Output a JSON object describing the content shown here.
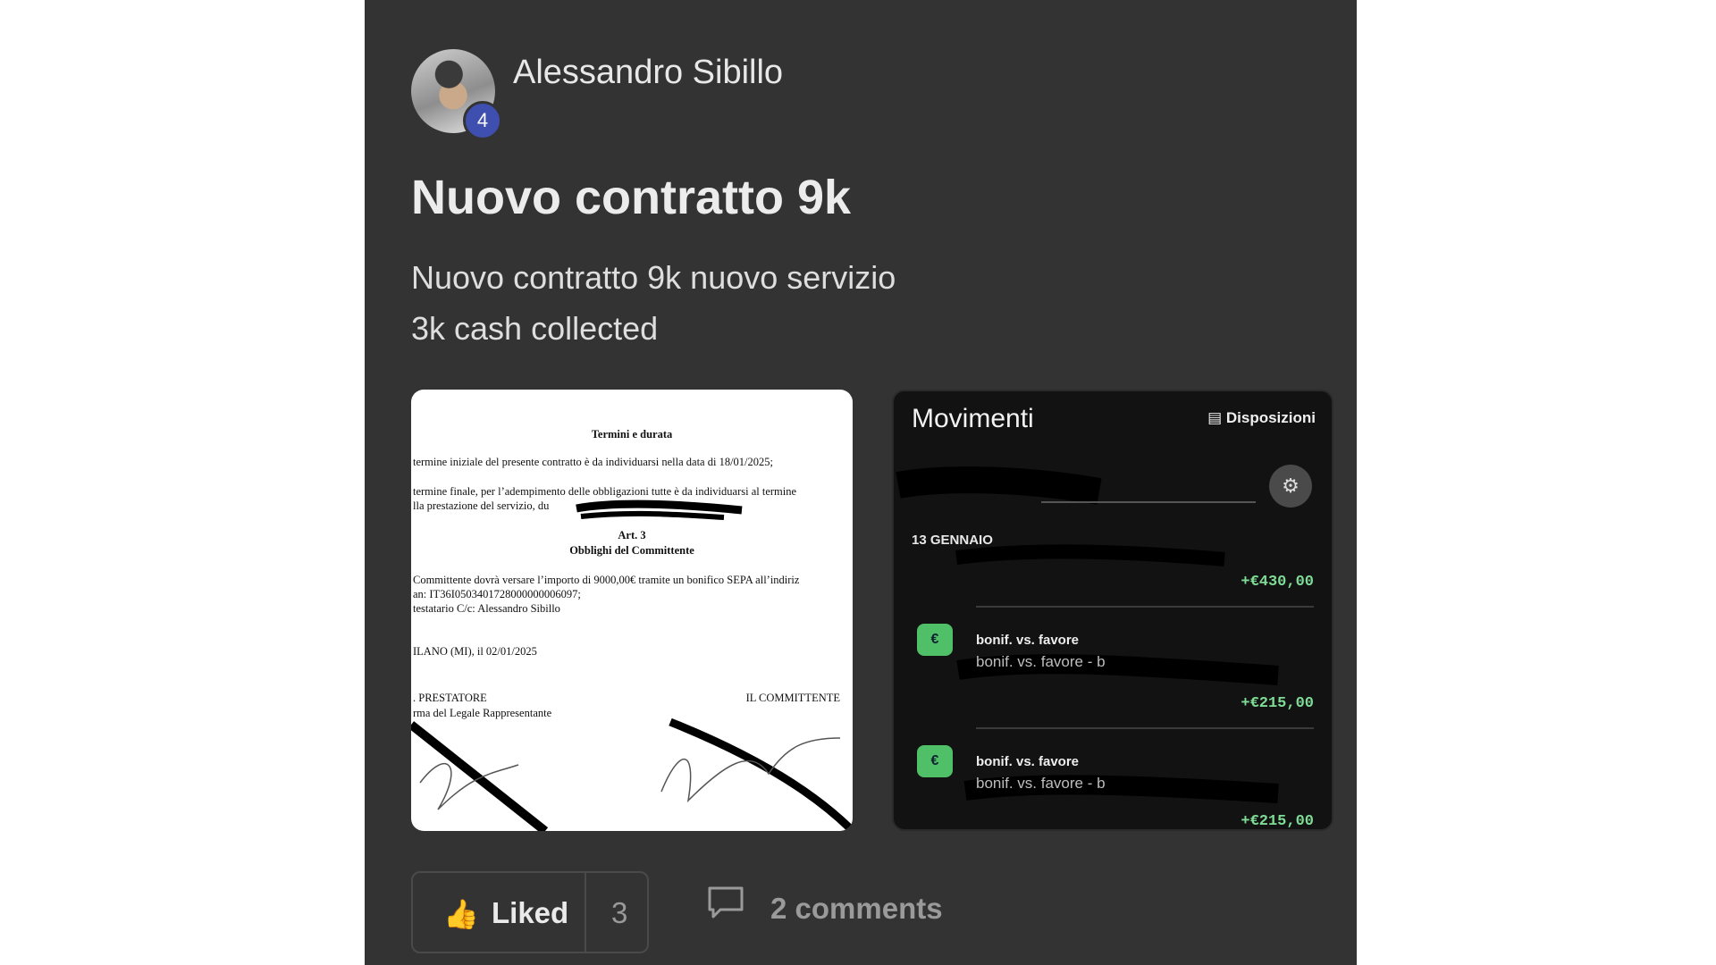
{
  "post": {
    "author": "Alessandro Sibillo",
    "author_level": "4",
    "title": "Nuovo contratto 9k",
    "body_line1": "Nuovo contratto 9k nuovo servizio",
    "body_line2": "3k cash collected"
  },
  "contract_image": {
    "heading": "Termini e durata",
    "line1": "termine iniziale del presente contratto è da individuarsi nella data di 18/01/2025;",
    "line2": "termine finale, per l’adempimento delle obbligazioni tutte è da individuarsi al termine",
    "line3": "lla prestazione del servizio, du",
    "art": "Art. 3",
    "art_title": "Obblighi del Committente",
    "line4": "Committente dovrà versare l’importo di 9000,00€ tramite un bonifico SEPA all’indiriz",
    "line5": "an: IT36I0503401728000000006097;",
    "line6": "testatario C/c: Alessandro Sibillo",
    "place_date": "ILANO (MI), il 02/01/2025",
    "prestatore": ". PRESTATORE",
    "committente": "IL COMMITTENTE",
    "firma": "rma del Legale Rappresentante"
  },
  "bank_image": {
    "title": "Movimenti",
    "action": "Disposizioni",
    "date": "13 GENNAIO",
    "transactions": [
      {
        "amount": "+€430,00"
      },
      {
        "name": "bonif. vs. favore",
        "desc": "bonif. vs. favore - b",
        "amount": "+€215,00"
      },
      {
        "name": "bonif. vs. favore",
        "desc": "bonif. vs. favore - b",
        "amount": "+€215,00"
      }
    ]
  },
  "actions": {
    "like_label": "Liked",
    "like_count": "3",
    "comments_label": "2 comments"
  },
  "colors": {
    "background": "#333333",
    "badge": "#3f4fb0",
    "amount_green": "#7fdc96",
    "thumb": "#f2b84b"
  },
  "icons": [
    "thumbs-up-icon",
    "comment-icon",
    "filter-icon",
    "wallet-icon"
  ]
}
